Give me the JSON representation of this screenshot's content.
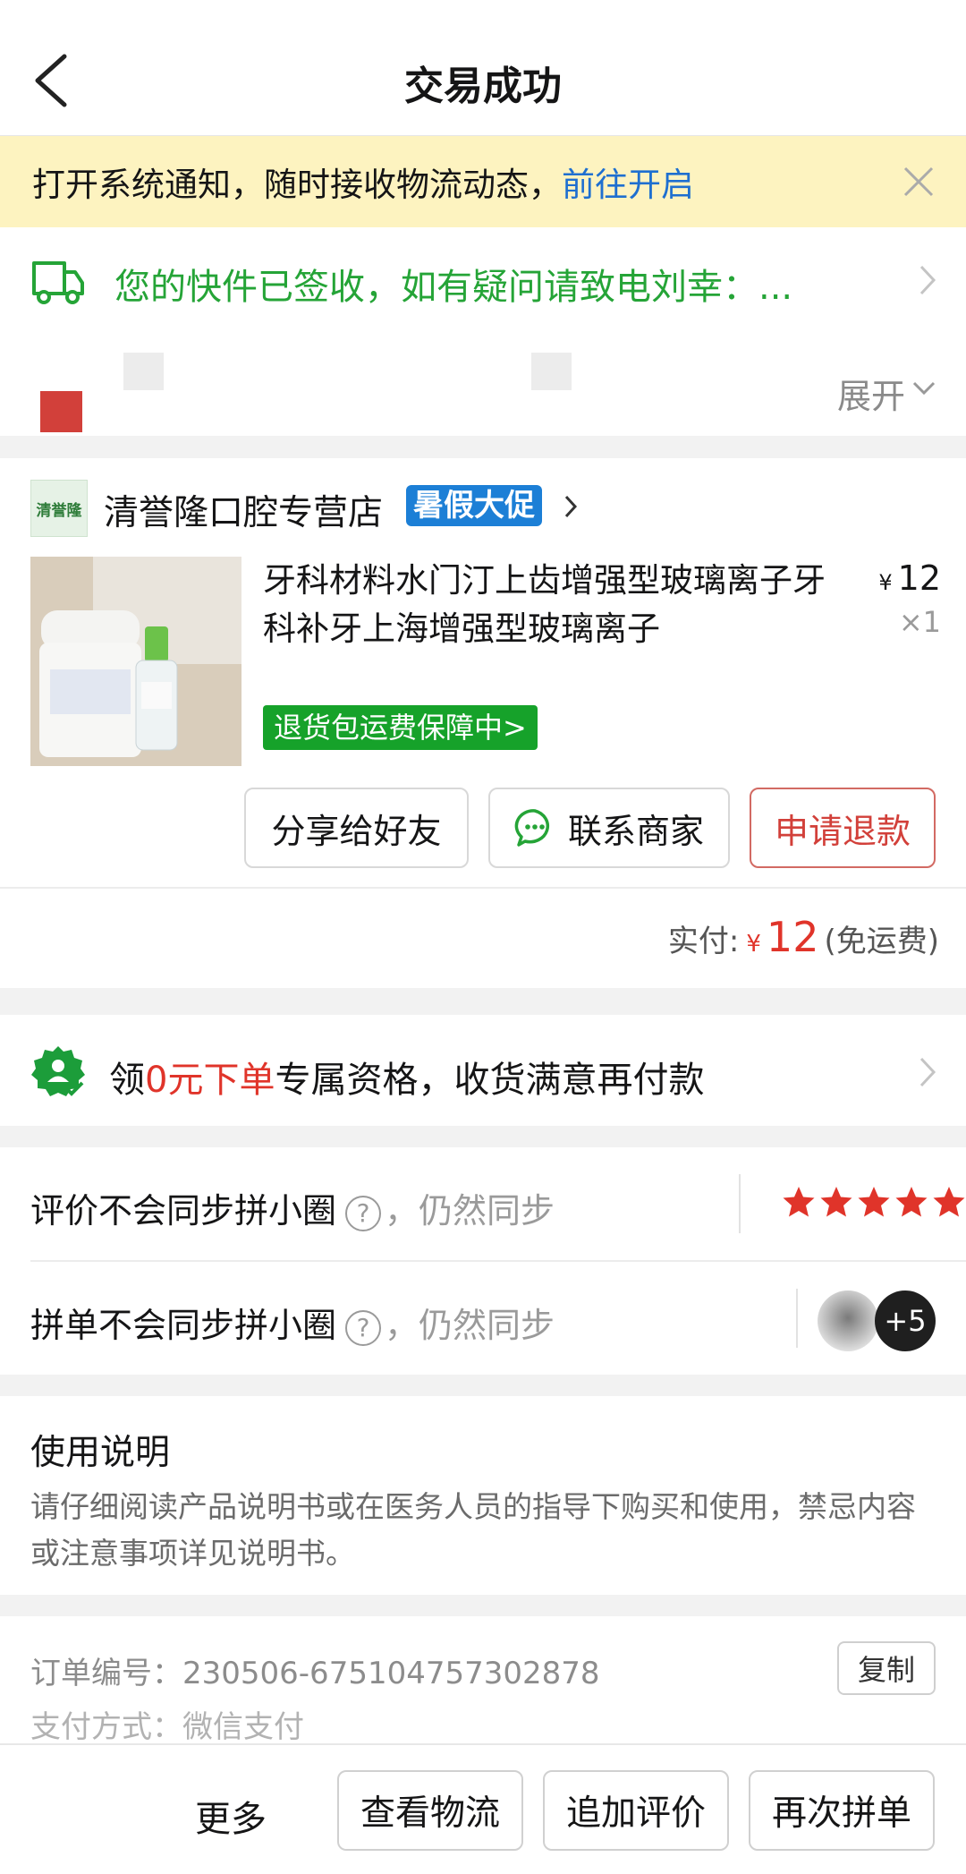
{
  "header": {
    "title": "交易成功"
  },
  "notice": {
    "text": "打开系统通知，随时接收物流动态，",
    "link": "前往开启"
  },
  "logistics": {
    "text": "您的快件已签收，如有疑问请致电刘幸：..."
  },
  "address": {
    "expand_label": "展开"
  },
  "store": {
    "logo_text": "清誉隆",
    "name": "清誉隆口腔专营店",
    "badge": "暑假大促"
  },
  "product": {
    "name": "牙科材料水门汀上齿增强型玻璃离子牙科补牙上海增强型玻璃离子",
    "currency": "¥",
    "price": "12",
    "quantity": "×1",
    "guarantee": "退货包运费保障中>"
  },
  "actions": {
    "share": "分享给好友",
    "contact": "联系商家",
    "refund": "申请退款"
  },
  "payment": {
    "label": "实付:",
    "currency": "¥",
    "amount": "12",
    "note": "(免运费)"
  },
  "promo": {
    "prefix": "领",
    "highlight": "0元下单",
    "suffix": "专属资格，收货满意再付款"
  },
  "review": {
    "row1_text": "评价不会同步拼小圈",
    "row1_sub": "，仍然同步",
    "rating": 5,
    "row2_text": "拼单不会同步拼小圈",
    "row2_sub": "，仍然同步",
    "extra_count": "+5",
    "help_symbol": "?"
  },
  "usage": {
    "title": "使用说明",
    "body": "请仔细阅读产品说明书或在医务人员的指导下购买和使用，禁忌内容或注意事项详见说明书。"
  },
  "order": {
    "number": "订单编号：230506-675104757302878",
    "copy_label": "复制",
    "pay_method": "支付方式：微信支付"
  },
  "bottom_bar": {
    "more": "更多",
    "logistics": "查看物流",
    "add_review": "追加评价",
    "reorder": "再次拼单"
  },
  "colors": {
    "accent_red": "#e0342a",
    "success_green": "#25a437",
    "link_blue": "#1e6fd0",
    "notice_bg": "#fdf3c0"
  }
}
